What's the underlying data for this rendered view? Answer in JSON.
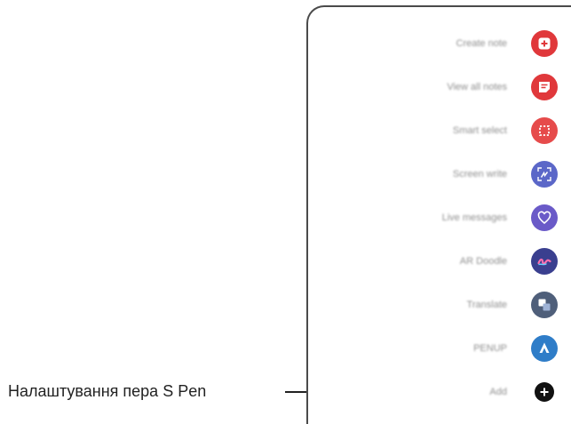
{
  "callout": {
    "label": "Налаштування пера S Pen"
  },
  "menu": {
    "items": [
      {
        "label": "Create note",
        "icon": "create-note-icon",
        "color": "#e0383b"
      },
      {
        "label": "View all notes",
        "icon": "view-notes-icon",
        "color": "#e0383b"
      },
      {
        "label": "Smart select",
        "icon": "smart-select-icon",
        "color": "#e64b4b"
      },
      {
        "label": "Screen write",
        "icon": "screen-write-icon",
        "color": "#5b67c8"
      },
      {
        "label": "Live messages",
        "icon": "live-messages-icon",
        "color": "#6a5ac8"
      },
      {
        "label": "AR Doodle",
        "icon": "ar-doodle-icon",
        "color": "#3a3f8f"
      },
      {
        "label": "Translate",
        "icon": "translate-icon",
        "color": "#4f5f7a"
      },
      {
        "label": "PENUP",
        "icon": "penup-icon",
        "color": "#2f7dc8"
      },
      {
        "label": "Add",
        "icon": "add-icon",
        "color": "#111111"
      }
    ]
  }
}
